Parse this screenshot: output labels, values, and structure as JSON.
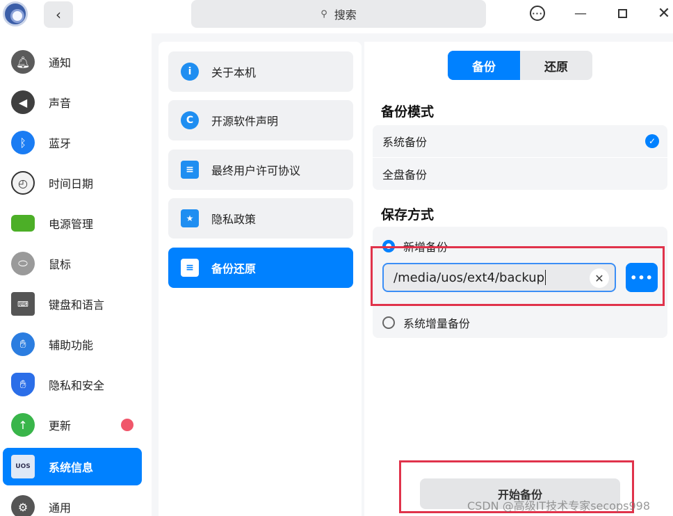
{
  "titlebar": {
    "search_placeholder": "搜索"
  },
  "sidebar": {
    "items": [
      {
        "label": "通知",
        "icon": "bell-icon",
        "color": "#5b5b5b"
      },
      {
        "label": "声音",
        "icon": "speaker-icon",
        "color": "#3f3f3f"
      },
      {
        "label": "蓝牙",
        "icon": "bluetooth-icon",
        "color": "#1a7cf3"
      },
      {
        "label": "时间日期",
        "icon": "clock-icon",
        "color": "#e8e8e8"
      },
      {
        "label": "电源管理",
        "icon": "battery-icon",
        "color": "#4caf27"
      },
      {
        "label": "鼠标",
        "icon": "mouse-icon",
        "color": "#9a9a9a"
      },
      {
        "label": "键盘和语言",
        "icon": "keyboard-icon",
        "color": "#555555"
      },
      {
        "label": "辅助功能",
        "icon": "hand-icon",
        "color": "#2b7de0"
      },
      {
        "label": "隐私和安全",
        "icon": "shield-icon",
        "color": "#2b6ee8"
      },
      {
        "label": "更新",
        "icon": "update-icon",
        "color": "#39b54a"
      },
      {
        "label": "系统信息",
        "icon": "system-info-icon",
        "color": "#5a86c8"
      },
      {
        "label": "通用",
        "icon": "gear-icon",
        "color": "#555555"
      }
    ]
  },
  "middle": {
    "items": [
      {
        "label": "关于本机",
        "icon": "info-icon",
        "glyph": "i",
        "color": "#1f8ef1"
      },
      {
        "label": "开源软件声明",
        "icon": "copyright-icon",
        "glyph": "C",
        "color": "#1f8ef1"
      },
      {
        "label": "最终用户许可协议",
        "icon": "document-icon",
        "glyph": "≡",
        "color": "#1f8ef1"
      },
      {
        "label": "隐私政策",
        "icon": "privacy-icon",
        "glyph": "★",
        "color": "#1f8ef1"
      },
      {
        "label": "备份还原",
        "icon": "backup-icon",
        "glyph": "≡",
        "color": "#ffffff"
      }
    ]
  },
  "content": {
    "tabs": [
      "备份",
      "还原"
    ],
    "backup_mode_title": "备份模式",
    "modes": [
      "系统备份",
      "全盘备份"
    ],
    "save_method_title": "保存方式",
    "save_options": [
      "新增备份",
      "系统增量备份"
    ],
    "path_value": "/media/uos/ext4/backup",
    "browse_label": "•••",
    "start_label": "开始备份"
  },
  "watermark": "CSDN @高级IT技术专家secops998",
  "colors": {
    "accent": "#0081ff",
    "highlight_box": "#e0334b",
    "badge": "#f0566a"
  }
}
